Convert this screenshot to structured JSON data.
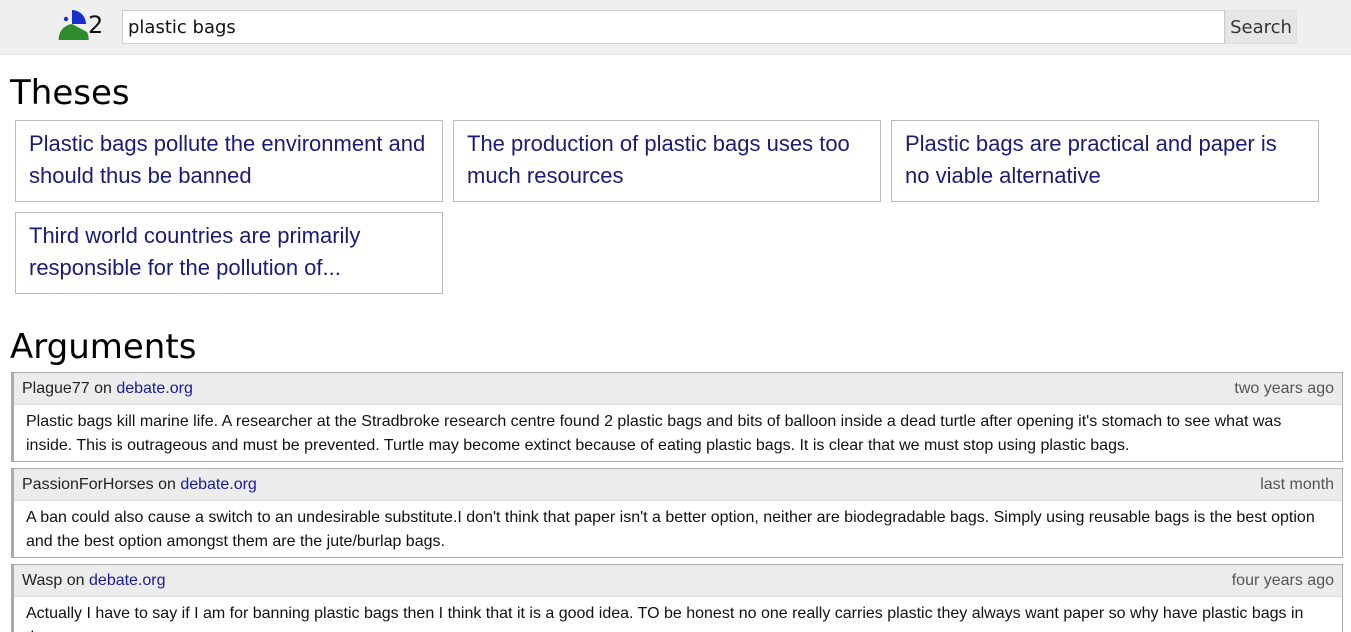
{
  "header": {
    "logo_number": "2",
    "search_value": "plastic bags",
    "search_button": "Search"
  },
  "theses": {
    "heading": "Theses",
    "items": [
      {
        "text": "Plastic bags pollute the environment and should thus be banned"
      },
      {
        "text": "The production of plastic bags uses too much resources"
      },
      {
        "text": "Plastic bags are practical and paper is no viable alternative"
      },
      {
        "text": "Third world countries are primarily responsible for the pollution of..."
      }
    ]
  },
  "arguments": {
    "heading": "Arguments",
    "items": [
      {
        "author": "Plague77",
        "on": "on",
        "source": "debate.org",
        "time": "two years ago",
        "text": "Plastic bags kill marine life. A researcher at the Stradbroke research centre found 2 plastic bags and bits of balloon inside a dead turtle after opening it's stomach to see what was inside. This is outrageous and must be prevented. Turtle may become extinct because of eating plastic bags. It is clear that we must stop using plastic bags."
      },
      {
        "author": "PassionForHorses",
        "on": "on",
        "source": "debate.org",
        "time": "last month",
        "text": "A ban could also cause a switch to an undesirable substitute.I don't think that paper isn't a better option, neither are biodegradable bags. Simply using reusable bags is the best option and the best option amongst them are the jute/burlap bags."
      },
      {
        "author": "Wasp",
        "on": "on",
        "source": "debate.org",
        "time": "four years ago",
        "text": "Actually I have to say if I am for banning plastic bags then I think that it is a good idea. TO be honest no one really carries plastic they always want paper so why have plastic bags in the"
      }
    ]
  },
  "colors": {
    "topbar": "#efefef",
    "thesis_text": "#1a1a7a",
    "link": "#1a1aa0",
    "logo_green": "#2e8b2e",
    "logo_blue": "#1a2fd0"
  }
}
